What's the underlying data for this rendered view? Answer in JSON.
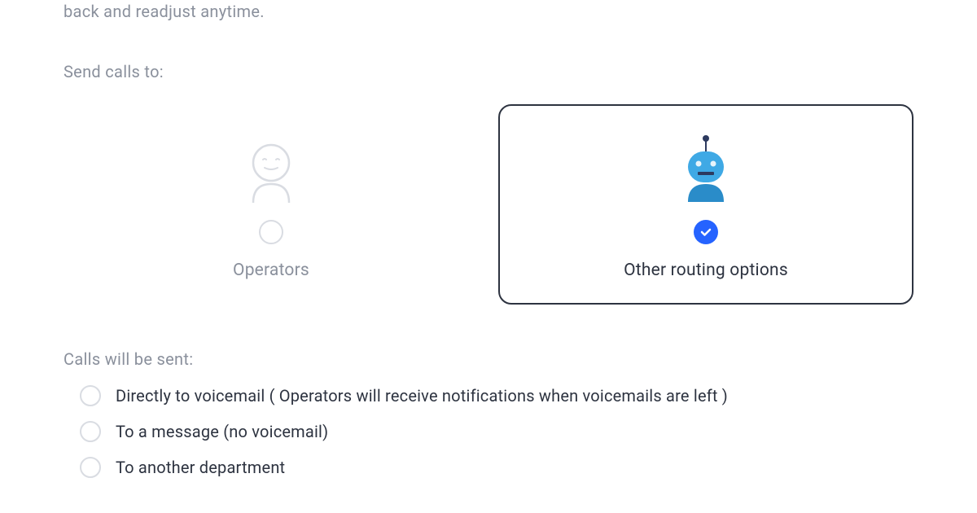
{
  "truncated_text": "back and readjust anytime.",
  "send_calls_label": "Send calls to:",
  "options": {
    "operators": {
      "label": "Operators",
      "selected": false
    },
    "other_routing": {
      "label": "Other routing options",
      "selected": true
    }
  },
  "calls_sent_label": "Calls will be sent:",
  "routing_options": [
    {
      "label": "Directly to voicemail ( Operators will receive notifications when voicemails are left )"
    },
    {
      "label": "To a message (no voicemail)"
    },
    {
      "label": "To another department"
    }
  ]
}
